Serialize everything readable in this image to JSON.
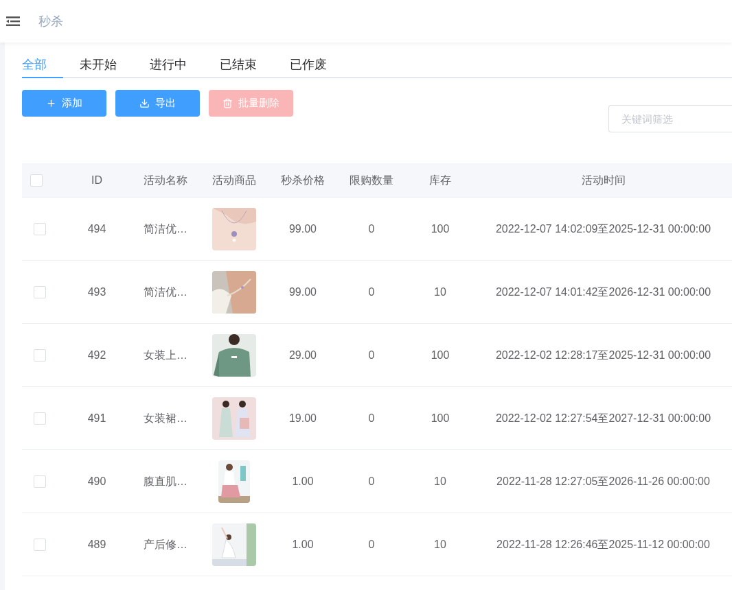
{
  "header": {
    "title": "秒杀"
  },
  "tabs": [
    {
      "label": "全部",
      "selected": true
    },
    {
      "label": "未开始",
      "selected": false
    },
    {
      "label": "进行中",
      "selected": false
    },
    {
      "label": "已结束",
      "selected": false
    },
    {
      "label": "已作废",
      "selected": false
    }
  ],
  "buttons": [
    {
      "kind": "add",
      "label": "添加",
      "disabled": false
    },
    {
      "kind": "export",
      "label": "导出",
      "disabled": false
    },
    {
      "kind": "delete",
      "label": "批量删除",
      "disabled": true
    }
  ],
  "search": {
    "placeholder": "关键词筛选"
  },
  "table": {
    "select_all": {
      "checked": false
    },
    "columns": [
      "ID",
      "活动名称",
      "活动商品",
      "秒杀价格",
      "限购数量",
      "库存",
      "活动时间"
    ],
    "rows": [
      {
        "checked": false,
        "id": "494",
        "name": "简洁优…",
        "price": "99.00",
        "limit": "0",
        "stock": "100",
        "time": "2022-12-07 14:02:09至2025-12-31 00:00:00"
      },
      {
        "checked": false,
        "id": "493",
        "name": "简洁优…",
        "price": "99.00",
        "limit": "0",
        "stock": "10",
        "time": "2022-12-07 14:01:42至2026-12-31 00:00:00"
      },
      {
        "checked": false,
        "id": "492",
        "name": "女装上…",
        "price": "29.00",
        "limit": "0",
        "stock": "100",
        "time": "2022-12-02 12:28:17至2025-12-31 00:00:00"
      },
      {
        "checked": false,
        "id": "491",
        "name": "女装裙…",
        "price": "19.00",
        "limit": "0",
        "stock": "100",
        "time": "2022-12-02 12:27:54至2027-12-31 00:00:00"
      },
      {
        "checked": false,
        "id": "490",
        "name": "腹直肌…",
        "price": "1.00",
        "limit": "0",
        "stock": "10",
        "time": "2022-11-28 12:27:05至2026-11-26 00:00:00"
      },
      {
        "checked": false,
        "id": "489",
        "name": "产后修…",
        "price": "1.00",
        "limit": "0",
        "stock": "10",
        "time": "2022-11-28 12:26:46至2025-11-12 00:00:00"
      }
    ]
  }
}
